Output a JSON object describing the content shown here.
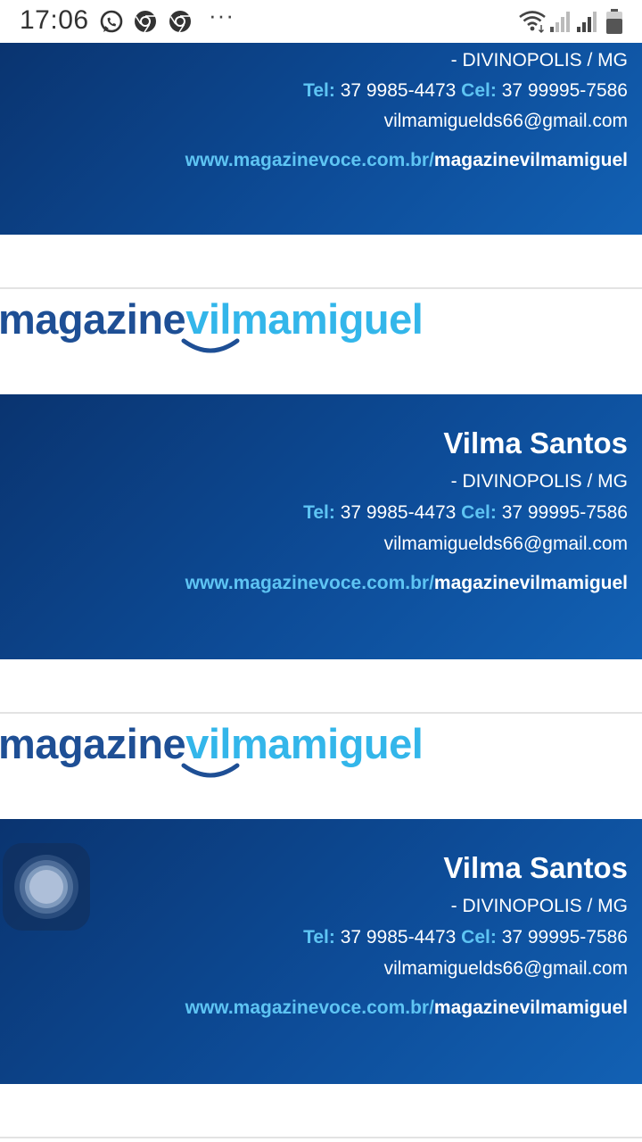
{
  "status_bar": {
    "time": "17:06",
    "icons": [
      "whatsapp-icon",
      "chrome-icon",
      "chrome-icon",
      "more-notifications-icon",
      "wifi-icon",
      "signal-icon",
      "signal-icon",
      "battery-icon"
    ],
    "dots": "···"
  },
  "cards": [
    {
      "city": "- DIVINOPOLIS / MG",
      "tel_label": "Tel:",
      "tel": "37 9985-4473",
      "cel_label": "Cel:",
      "cel": "37 99995-7586",
      "email": "vilmamiguelds66@gmail.com",
      "web_base": "www.magazinevoce.com.br/",
      "web_path": "magazinevilmamiguel"
    },
    {
      "name": "Vilma Santos",
      "city": "- DIVINOPOLIS / MG",
      "tel_label": "Tel:",
      "tel": "37 9985-4473",
      "cel_label": "Cel:",
      "cel": "37 99995-7586",
      "email": "vilmamiguelds66@gmail.com",
      "web_base": "www.magazinevoce.com.br/",
      "web_path": "magazinevilmamiguel"
    },
    {
      "name": "Vilma Santos",
      "city": "- DIVINOPOLIS / MG",
      "tel_label": "Tel:",
      "tel": "37 9985-4473",
      "cel_label": "Cel:",
      "cel": "37 99995-7586",
      "email": "vilmamiguelds66@gmail.com",
      "web_base": "www.magazinevoce.com.br/",
      "web_path": "magazinevilmamiguel"
    }
  ],
  "logo": {
    "part1": "magazine",
    "part2": "vilmamiguel"
  },
  "colors": {
    "card_dark": "#0a3470",
    "card_light": "#1261b4",
    "highlight": "#5ec4f3",
    "logo_dark": "#1e4f95",
    "logo_light": "#33b6ea"
  },
  "floating_button": {
    "icon": "assistant-bubble-icon"
  }
}
